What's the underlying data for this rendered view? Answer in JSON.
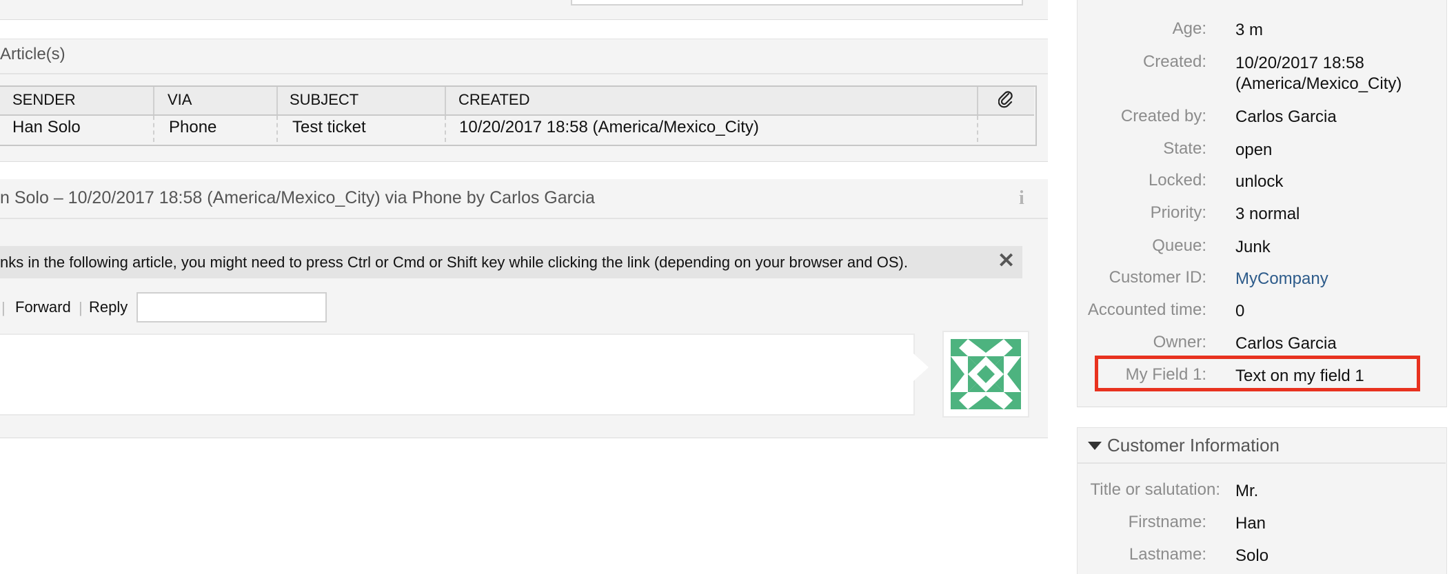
{
  "articles": {
    "title": "Article(s)",
    "columns": [
      "SENDER",
      "VIA",
      "SUBJECT",
      "CREATED"
    ],
    "attachment_column_icon": "paperclip-icon",
    "rows": [
      {
        "sender": "Han Solo",
        "via": "Phone",
        "subject": "Test ticket",
        "created": "10/20/2017 18:58 (America/Mexico_City)"
      }
    ]
  },
  "article": {
    "title": "n Solo – 10/20/2017 18:58 (America/Mexico_City) via Phone by Carlos Garcia",
    "info_icon": "info-icon",
    "notice": "nks in the following article, you might need to press Ctrl or Cmd or Shift key while clicking the link (depending on your browser and OS).",
    "close_icon": "close-icon",
    "actions": {
      "forward": "Forward",
      "reply": "Reply"
    },
    "reply_value": ""
  },
  "ticket_info": {
    "fields": [
      {
        "label": "Age:",
        "value": "3 m"
      },
      {
        "label": "Created:",
        "value": "10/20/2017 18:58",
        "value2": "(America/Mexico_City)"
      },
      {
        "label": "Created by:",
        "value": "Carlos Garcia"
      },
      {
        "label": "State:",
        "value": "open"
      },
      {
        "label": "Locked:",
        "value": "unlock"
      },
      {
        "label": "Priority:",
        "value": "3 normal"
      },
      {
        "label": "Queue:",
        "value": "Junk"
      },
      {
        "label": "Customer ID:",
        "value": "MyCompany"
      },
      {
        "label": "Accounted time:",
        "value": "0"
      },
      {
        "label": "Owner:",
        "value": "Carlos Garcia"
      },
      {
        "label": "My Field 1:",
        "value": "Text on my field 1"
      }
    ],
    "highlight_color": "#e8321f",
    "link_color": "#2d5b8a"
  },
  "customer_info": {
    "title": "Customer Information",
    "fields": [
      {
        "label": "Title or salutation:",
        "value": "Mr."
      },
      {
        "label": "Firstname:",
        "value": "Han"
      },
      {
        "label": "Lastname:",
        "value": "Solo"
      }
    ]
  },
  "colors": {
    "avatar_green": "#4db37f",
    "panel_bg": "#f4f4f4"
  }
}
